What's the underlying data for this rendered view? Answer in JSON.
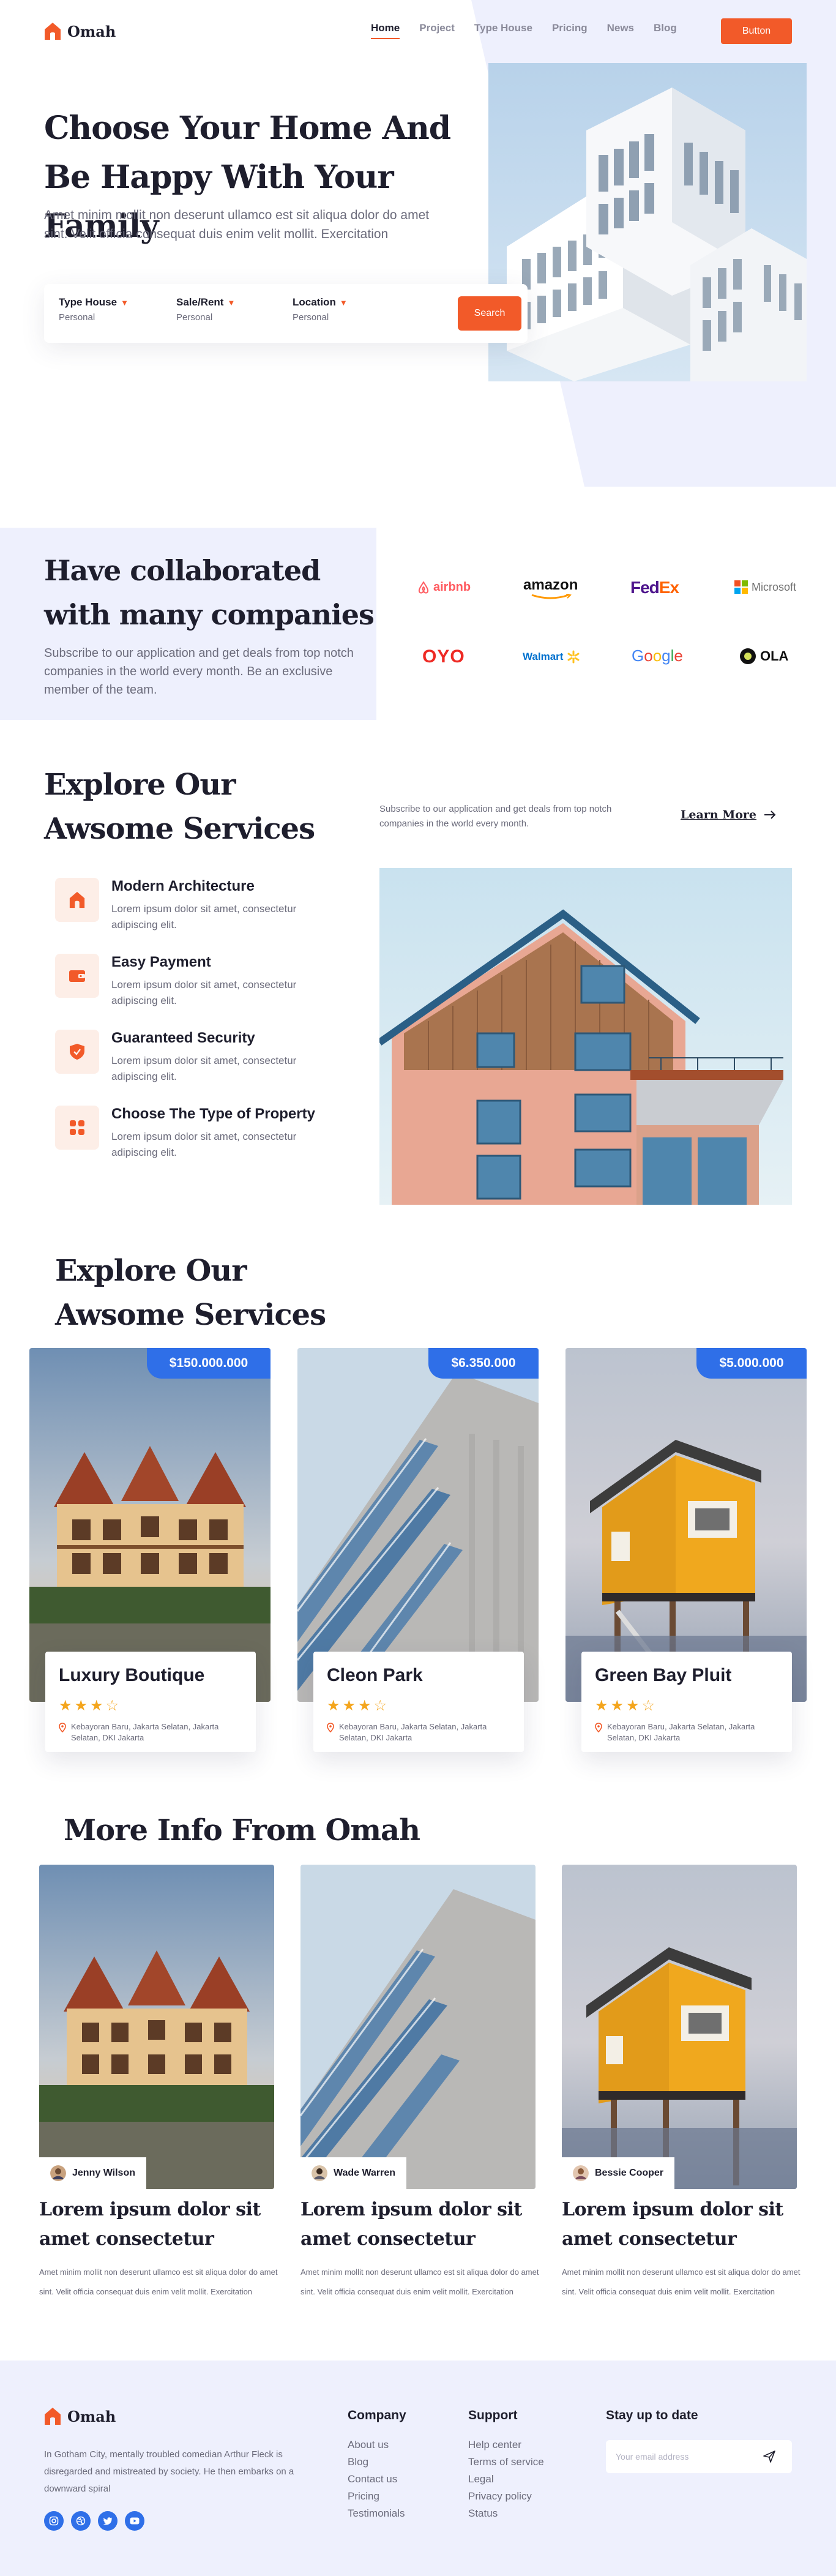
{
  "colors": {
    "accent": "#f25a29",
    "blue": "#2f6fe8",
    "lavender": "#eef0fd",
    "star": "#f4a51c",
    "text": "#1e1e2d",
    "muted": "#6b6b7b"
  },
  "brand": {
    "name": "Omah",
    "icon": "house-icon"
  },
  "nav": {
    "items": [
      "Home",
      "Project",
      "Type House",
      "Pricing",
      "News",
      "Blog"
    ],
    "active": "Home",
    "button": "Button"
  },
  "hero": {
    "title": "Choose Your Home And Be Happy With Your Family",
    "description": "Amet minim mollit non deserunt ullamco est sit aliqua dolor do amet sint. Velit officia consequat duis enim velit mollit. Exercitation",
    "search": {
      "fields": [
        {
          "label": "Type House",
          "value": "Personal"
        },
        {
          "label": "Sale/Rent",
          "value": "Personal"
        },
        {
          "label": "Location",
          "value": "Personal"
        }
      ],
      "button": "Search"
    }
  },
  "collab": {
    "title": "Have collaborated with many companies",
    "description": "Subscribe to our application and get deals from top notch companies in the world every month. Be an exclusive member of the team.",
    "brands": [
      "airbnb",
      "amazon",
      "FedEx",
      "Microsoft",
      "OYO",
      "Walmart",
      "Google",
      "OLA"
    ]
  },
  "services": {
    "title": "Explore Our Awsome Services",
    "subtitle": "Subscribe to our application and get deals from top notch companies in the world every month.",
    "learn_more": "Learn More",
    "items": [
      {
        "name": "Modern Architecture",
        "desc": "Lorem ipsum dolor sit amet, consectetur adipiscing elit.",
        "icon": "house-icon"
      },
      {
        "name": "Easy Payment",
        "desc": "Lorem ipsum dolor sit amet, consectetur adipiscing elit.",
        "icon": "wallet-icon"
      },
      {
        "name": "Guaranteed Security",
        "desc": "Lorem ipsum dolor sit amet, consectetur adipiscing elit.",
        "icon": "shield-icon"
      },
      {
        "name": "Choose The Type of Property",
        "desc": "Lorem ipsum dolor sit amet, consectetur adipiscing elit.",
        "icon": "grid-icon"
      }
    ]
  },
  "properties": {
    "title": "Explore Our Awsome Services",
    "items": [
      {
        "name": "Luxury Boutique",
        "price": "$150.000.000",
        "rating": 3,
        "max_rating": 4,
        "address": "Kebayoran Baru, Jakarta Selatan, Jakarta Selatan, DKI Jakarta"
      },
      {
        "name": "Cleon Park",
        "price": "$6.350.000",
        "rating": 3,
        "max_rating": 4,
        "address": "Kebayoran Baru, Jakarta Selatan, Jakarta Selatan, DKI Jakarta"
      },
      {
        "name": "Green Bay Pluit",
        "price": "$5.000.000",
        "rating": 3,
        "max_rating": 4,
        "address": "Kebayoran Baru, Jakarta Selatan, Jakarta Selatan, DKI Jakarta"
      }
    ]
  },
  "blog": {
    "title": "More Info From Omah",
    "items": [
      {
        "author": "Jenny Wilson",
        "title": "Lorem ipsum dolor sit amet consectetur",
        "desc": "Amet minim mollit non deserunt ullamco est sit aliqua dolor do amet sint. Velit officia consequat duis enim velit mollit. Exercitation"
      },
      {
        "author": "Wade Warren",
        "title": "Lorem ipsum dolor sit amet consectetur",
        "desc": "Amet minim mollit non deserunt ullamco est sit aliqua dolor do amet sint. Velit officia consequat duis enim velit mollit. Exercitation"
      },
      {
        "author": "Bessie Cooper",
        "title": "Lorem ipsum dolor sit amet consectetur",
        "desc": "Amet minim mollit non deserunt ullamco est sit aliqua dolor do amet sint. Velit officia consequat duis enim velit mollit. Exercitation"
      }
    ]
  },
  "footer": {
    "description": "In Gotham City, mentally troubled comedian Arthur Fleck is disregarded and mistreated by society. He then embarks on a downward spiral",
    "social": [
      "instagram-icon",
      "dribbble-icon",
      "twitter-icon",
      "youtube-icon"
    ],
    "company": {
      "title": "Company",
      "links": [
        "About us",
        "Blog",
        "Contact us",
        "Pricing",
        "Testimonials"
      ]
    },
    "support": {
      "title": "Support",
      "links": [
        "Help center",
        "Terms of service",
        "Legal",
        "Privacy policy",
        "Status"
      ]
    },
    "newsletter": {
      "title": "Stay up to date",
      "placeholder": "Your email address"
    }
  }
}
